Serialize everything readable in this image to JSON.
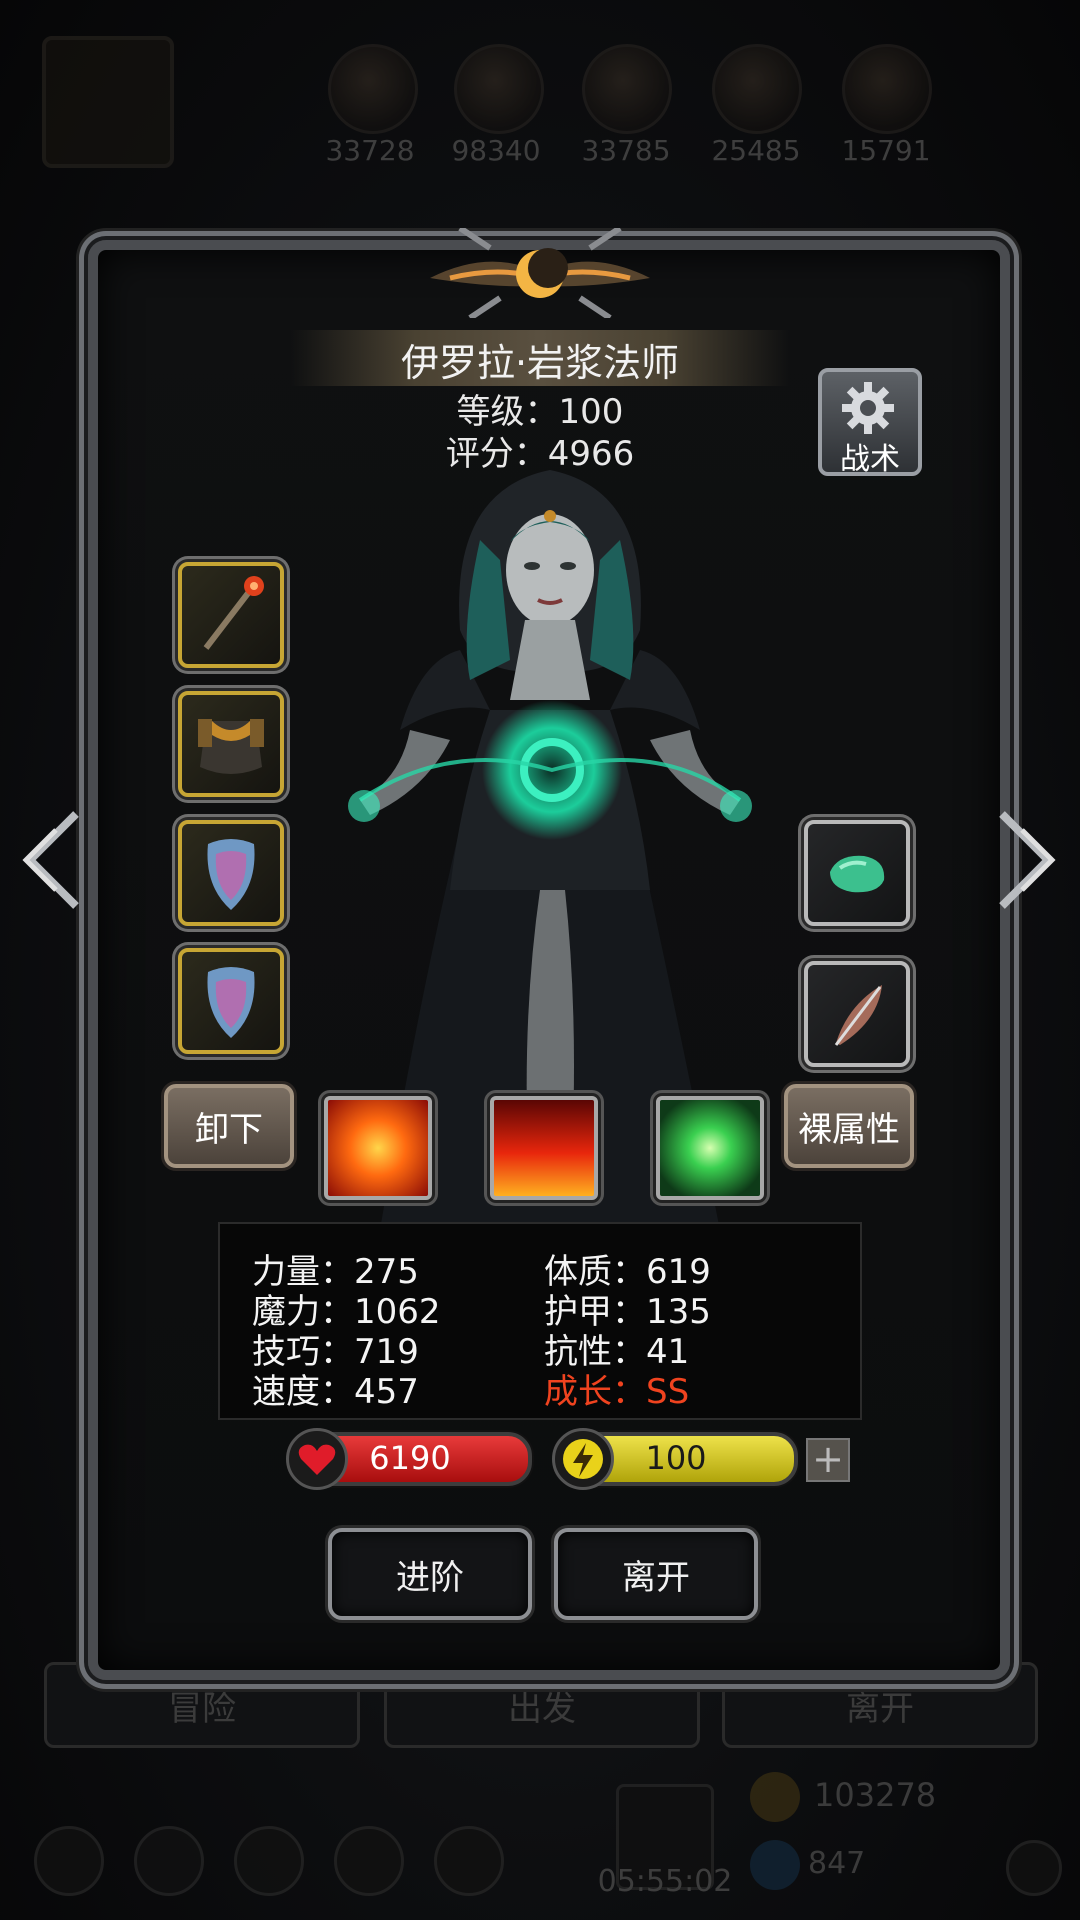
{
  "background": {
    "resources": [
      "33728",
      "98340",
      "33785",
      "25485",
      "15791"
    ],
    "nav_buttons": [
      "冒险",
      "出发",
      "离开"
    ],
    "currency_gold": "103278",
    "currency_gem": "847",
    "timer": "05:55:02"
  },
  "hero": {
    "name": "伊罗拉·岩浆法师",
    "level_text": "等级：100",
    "score_text": "评分：4966",
    "tactics_label": "战术"
  },
  "equipment": {
    "left_slots": [
      "staff-icon",
      "armor-icon",
      "shield-icon",
      "shield-icon"
    ],
    "right_slots": [
      "green-gem-icon",
      "feather-icon"
    ]
  },
  "actions": {
    "unequip": "卸下",
    "base_attributes": "裸属性"
  },
  "skills": [
    "fire-explosion-icon",
    "flame-icon",
    "green-crystal-icon"
  ],
  "stats": {
    "left": [
      "力量：275",
      "魔力：1062",
      "技巧：719",
      "速度：457"
    ],
    "right": [
      "体质：619",
      "护甲：135",
      "抗性：41",
      "成长：SS"
    ]
  },
  "bars": {
    "hp": "6190",
    "energy": "100"
  },
  "buttons": {
    "advance": "进阶",
    "leave": "离开"
  },
  "colors": {
    "accent_gold": "#c7a634",
    "growth_red": "#f0431f",
    "hp_red": "#c41616",
    "energy_yellow": "#d9cc14"
  }
}
